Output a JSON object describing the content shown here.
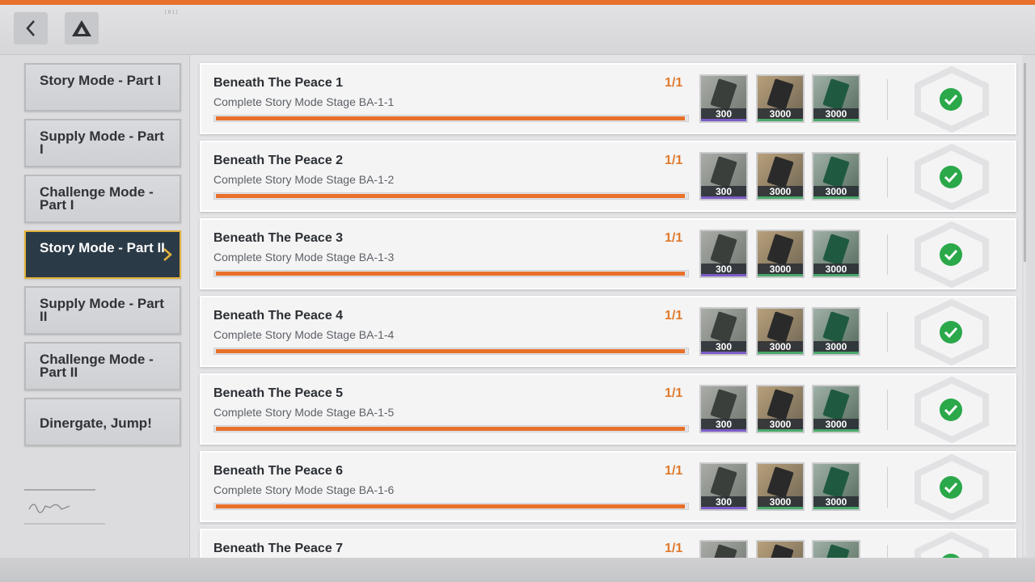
{
  "colors": {
    "accent": "#e8702a",
    "active_bg": "#2b3a47",
    "active_border": "#e2b33b",
    "check_green": "#2aa84a"
  },
  "header": {
    "back_icon": "chevron-left-icon",
    "home_icon": "triangle-logo-icon",
    "deco_left": "[01]"
  },
  "sidebar": {
    "items": [
      {
        "label": "Story Mode - Part I",
        "active": false
      },
      {
        "label": "Supply Mode - Part I",
        "active": false
      },
      {
        "label": "Challenge Mode - Part I",
        "active": false
      },
      {
        "label": "Story Mode - Part II",
        "active": true
      },
      {
        "label": "Supply Mode - Part II",
        "active": false
      },
      {
        "label": "Challenge Mode - Part II",
        "active": false
      },
      {
        "label": "Dinergate, Jump!",
        "active": false
      }
    ]
  },
  "missions": [
    {
      "title": "Beneath The Peace 1",
      "desc": "Complete Story Mode Stage BA-1-1",
      "count": "1/1",
      "progress": 1.0,
      "rewards": [
        "300",
        "3000",
        "3000"
      ],
      "completed": true
    },
    {
      "title": "Beneath The Peace 2",
      "desc": "Complete Story Mode Stage BA-1-2",
      "count": "1/1",
      "progress": 1.0,
      "rewards": [
        "300",
        "3000",
        "3000"
      ],
      "completed": true
    },
    {
      "title": "Beneath The Peace 3",
      "desc": "Complete Story Mode Stage BA-1-3",
      "count": "1/1",
      "progress": 1.0,
      "rewards": [
        "300",
        "3000",
        "3000"
      ],
      "completed": true
    },
    {
      "title": "Beneath The Peace 4",
      "desc": "Complete Story Mode Stage BA-1-4",
      "count": "1/1",
      "progress": 1.0,
      "rewards": [
        "300",
        "3000",
        "3000"
      ],
      "completed": true
    },
    {
      "title": "Beneath The Peace 5",
      "desc": "Complete Story Mode Stage BA-1-5",
      "count": "1/1",
      "progress": 1.0,
      "rewards": [
        "300",
        "3000",
        "3000"
      ],
      "completed": true
    },
    {
      "title": "Beneath The Peace 6",
      "desc": "Complete Story Mode Stage BA-1-6",
      "count": "1/1",
      "progress": 1.0,
      "rewards": [
        "300",
        "3000",
        "3000"
      ],
      "completed": true
    },
    {
      "title": "Beneath The Peace 7",
      "desc": "",
      "count": "1/1",
      "progress": 1.0,
      "rewards": [
        "",
        "",
        ""
      ],
      "completed": true
    }
  ]
}
